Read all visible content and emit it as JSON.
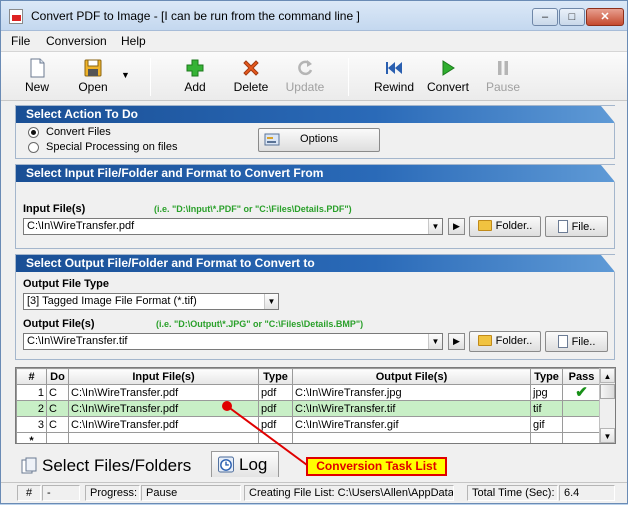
{
  "window": {
    "title": "Convert PDF to Image - [I can be run from the command line ]",
    "minimize": "–",
    "maximize": "□",
    "close": "✕"
  },
  "menu": [
    "File",
    "Conversion",
    "Help"
  ],
  "toolbar": {
    "new": "New",
    "open": "Open",
    "add": "Add",
    "delete": "Delete",
    "update": "Update",
    "rewind": "Rewind",
    "convert": "Convert",
    "pause": "Pause"
  },
  "action": {
    "header": "Select Action To Do",
    "option1": "Convert Files",
    "option2": "Special Processing on files",
    "options_button": "Options"
  },
  "input": {
    "header": "Select Input File/Folder and Format to Convert From",
    "label": "Input File(s)",
    "hint": "(i.e. \"D:\\Input\\*.PDF\"  or \"C:\\Files\\Details.PDF\")",
    "value": "C:\\In\\WireTransfer.pdf",
    "folder_button": "Folder..",
    "file_button": "File.."
  },
  "output": {
    "header": "Select Output File/Folder and Format to Convert to",
    "type_label": "Output File Type",
    "type_value": "[3] Tagged Image File Format (*.tif)",
    "label": "Output File(s)",
    "hint": "(i.e. \"D:\\Output\\*.JPG\"  or \"C:\\Files\\Details.BMP\")",
    "value": "C:\\In\\WireTransfer.tif",
    "folder_button": "Folder..",
    "file_button": "File.."
  },
  "grid": {
    "headers": [
      "#",
      "Do",
      "Input File(s)",
      "Type",
      "Output File(s)",
      "Type",
      "Pass"
    ],
    "rows": [
      [
        "1",
        "C",
        "C:\\In\\WireTransfer.pdf",
        "pdf",
        "C:\\In\\WireTransfer.jpg",
        "jpg",
        "✔"
      ],
      [
        "2",
        "C",
        "C:\\In\\WireTransfer.pdf",
        "pdf",
        "C:\\In\\WireTransfer.tif",
        "tif",
        ""
      ],
      [
        "3",
        "C",
        "C:\\In\\WireTransfer.pdf",
        "pdf",
        "C:\\In\\WireTransfer.gif",
        "gif",
        ""
      ],
      [
        "*",
        "",
        "",
        "",
        "",
        "",
        ""
      ]
    ],
    "selected_row": 1
  },
  "tabs": {
    "select_files": "Select Files/Folders",
    "log": "Log"
  },
  "annotation": "Conversion Task List",
  "status": {
    "hash": "#",
    "dash": "-",
    "progress": "Progress:",
    "progress_value": "Pause",
    "creating": "Creating File List: C:\\Users\\Allen\\AppData\\",
    "total_time": "Total Time (Sec):",
    "total_time_value": "6.4"
  },
  "colors": {
    "section_header": "#1a4f95",
    "selected_row": "#c8efc6",
    "hint_text": "#2aa02a",
    "annotation_border": "#e00000",
    "annotation_fill": "#ffff00"
  }
}
